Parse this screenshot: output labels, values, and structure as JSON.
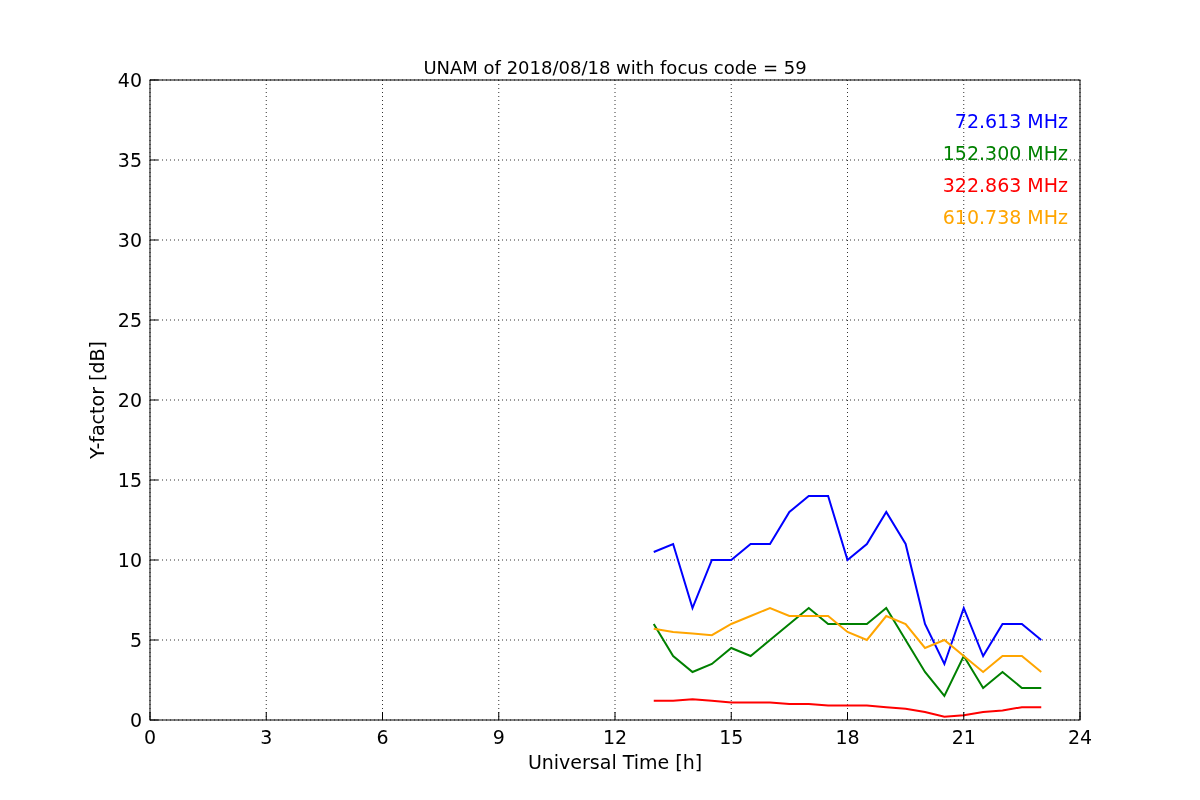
{
  "figure": {
    "chart_data": {
      "type": "line",
      "title": "UNAM of 2018/08/18 with focus code = 59",
      "xlabel": "Universal Time [h]",
      "ylabel": "Y-factor [dB]",
      "x": [
        13,
        13.5,
        14,
        14.5,
        15,
        15.5,
        16,
        16.5,
        17,
        17.5,
        18,
        18.5,
        19,
        19.5,
        20,
        20.5,
        21,
        21.5,
        22,
        22.5,
        23
      ],
      "series": [
        {
          "name": "72.613 MHz",
          "color": "#0000ff",
          "values": [
            10.5,
            11,
            7,
            10,
            10,
            11,
            11,
            13,
            14,
            14,
            10,
            11,
            13,
            11,
            6,
            3.5,
            7,
            4,
            6,
            6,
            5
          ]
        },
        {
          "name": "152.300 MHz",
          "color": "#008000",
          "values": [
            6,
            4,
            3,
            3.5,
            4.5,
            4,
            5,
            6,
            7,
            6,
            6,
            6,
            7,
            5,
            3,
            1.5,
            4,
            2,
            3,
            2,
            2
          ]
        },
        {
          "name": "322.863 MHz",
          "color": "#ff0000",
          "values": [
            1.2,
            1.2,
            1.3,
            1.2,
            1.1,
            1.1,
            1.1,
            1,
            1,
            0.9,
            0.9,
            0.9,
            0.8,
            0.7,
            0.5,
            0.2,
            0.3,
            0.5,
            0.6,
            0.8,
            0.8
          ]
        },
        {
          "name": "610.738 MHz",
          "color": "#ffa500",
          "values": [
            5.7,
            5.5,
            5.4,
            5.3,
            6,
            6.5,
            7,
            6.5,
            6.5,
            6.5,
            5.5,
            5,
            6.5,
            6,
            4.5,
            5,
            4,
            3,
            4,
            4,
            3
          ]
        }
      ],
      "grid": true,
      "xlim": [
        0,
        24
      ],
      "ylim": [
        0,
        40
      ],
      "xticks": [
        0,
        3,
        6,
        9,
        12,
        15,
        18,
        21,
        24
      ],
      "yticks": [
        0,
        5,
        10,
        15,
        20,
        25,
        30,
        35,
        40
      ]
    }
  }
}
